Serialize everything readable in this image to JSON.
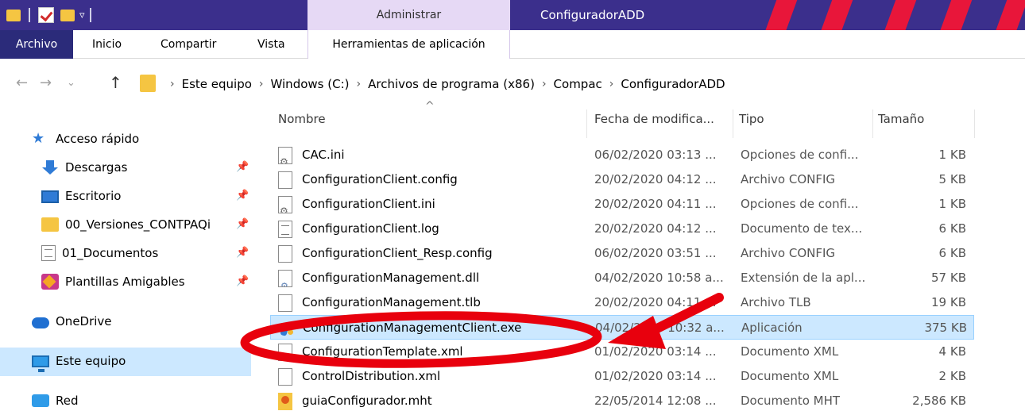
{
  "title_bar": {
    "context_header": "Administrar",
    "window_title": "ConfiguradorADD",
    "accent_color": "#3b2f8c"
  },
  "ribbon": {
    "tabs": [
      "Archivo",
      "Inicio",
      "Compartir",
      "Vista",
      "Herramientas de aplicación"
    ]
  },
  "address_bar": {
    "breadcrumbs": [
      "Este equipo",
      "Windows (C:)",
      "Archivos de programa (x86)",
      "Compac",
      "ConfiguradorADD"
    ]
  },
  "nav_pane": {
    "quick_access": "Acceso rápido",
    "pinned": [
      "Descargas",
      "Escritorio",
      "00_Versiones_CONTPAQi",
      "01_Documentos",
      "Plantillas Amigables"
    ],
    "onedrive": "OneDrive",
    "this_pc": "Este equipo",
    "network": "Red"
  },
  "columns": {
    "name": "Nombre",
    "date": "Fecha de modifica...",
    "type": "Tipo",
    "size": "Tamaño"
  },
  "files": [
    {
      "name": "CAC.ini",
      "date": "06/02/2020 03:13 ...",
      "type": "Opciones de confi...",
      "size": "1 KB",
      "icon": "settings-file-icon"
    },
    {
      "name": "ConfigurationClient.config",
      "date": "20/02/2020 04:12 ...",
      "type": "Archivo CONFIG",
      "size": "5 KB",
      "icon": "blank-file-icon"
    },
    {
      "name": "ConfigurationClient.ini",
      "date": "20/02/2020 04:11 ...",
      "type": "Opciones de confi...",
      "size": "1 KB",
      "icon": "settings-file-icon"
    },
    {
      "name": "ConfigurationClient.log",
      "date": "20/02/2020 04:12 ...",
      "type": "Documento de tex...",
      "size": "6 KB",
      "icon": "text-file-icon"
    },
    {
      "name": "ConfigurationClient_Resp.config",
      "date": "06/02/2020 03:51 ...",
      "type": "Archivo CONFIG",
      "size": "6 KB",
      "icon": "blank-file-icon"
    },
    {
      "name": "ConfigurationManagement.dll",
      "date": "04/02/2020 10:58 a...",
      "type": "Extensión de la apl...",
      "size": "57 KB",
      "icon": "dll-file-icon"
    },
    {
      "name": "ConfigurationManagement.tlb",
      "date": "20/02/2020 04:11 ...",
      "type": "Archivo TLB",
      "size": "19 KB",
      "icon": "blank-file-icon"
    },
    {
      "name": "ConfigurationManagementClient.exe",
      "date": "04/02/2020 10:32 a...",
      "type": "Aplicación",
      "size": "375 KB",
      "icon": "exe-file-icon",
      "selected": true
    },
    {
      "name": "ConfigurationTemplate.xml",
      "date": "01/02/2020 03:14 ...",
      "type": "Documento XML",
      "size": "4 KB",
      "icon": "blank-file-icon"
    },
    {
      "name": "ControlDistribution.xml",
      "date": "01/02/2020 03:14 ...",
      "type": "Documento XML",
      "size": "2 KB",
      "icon": "blank-file-icon"
    },
    {
      "name": "guiaConfigurador.mht",
      "date": "22/05/2014 12:08 ...",
      "type": "Documento MHT",
      "size": "2,586 KB",
      "icon": "mht-file-icon"
    }
  ],
  "annotation_color": "#e8000d"
}
